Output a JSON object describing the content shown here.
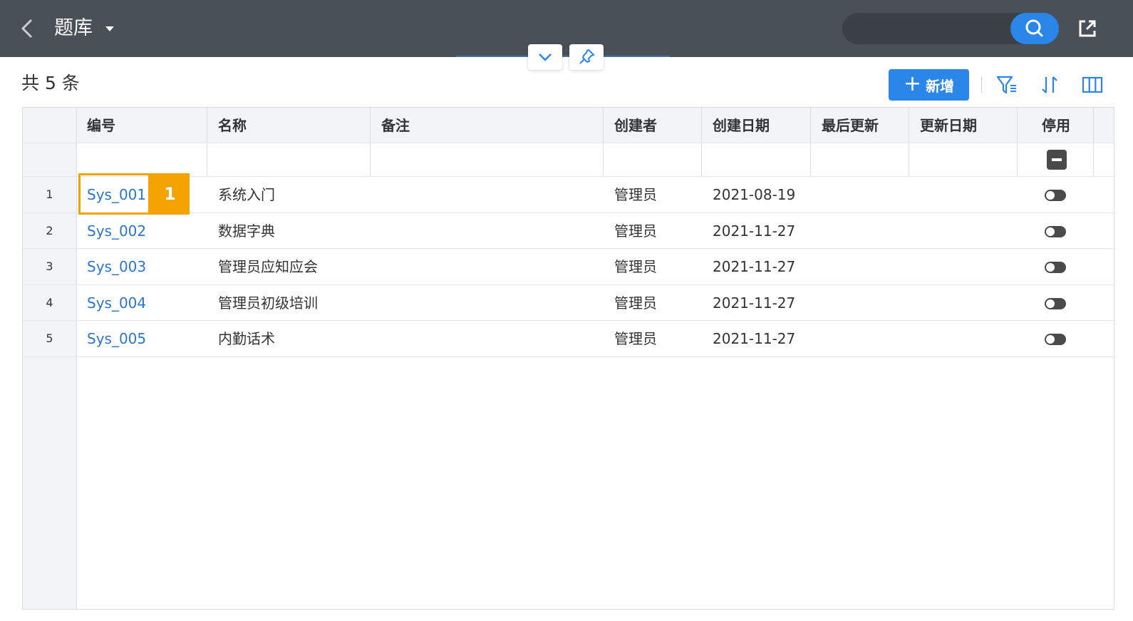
{
  "header": {
    "title": "题库",
    "icons": {
      "back": "chevron-left-icon",
      "caret": "caret-down-icon",
      "search": "search-icon",
      "share": "external-share-icon"
    }
  },
  "toolbar": {
    "total_label": "共 5 条",
    "add_label": "新增",
    "icons": [
      "filter-icon",
      "sort-icon",
      "columns-icon"
    ]
  },
  "table": {
    "columns": [
      "编号",
      "名称",
      "备注",
      "创建者",
      "创建日期",
      "最后更新",
      "更新日期",
      "停用"
    ],
    "rows": [
      {
        "num": "1",
        "code": "Sys_001",
        "name": "系统入门",
        "remark": "",
        "creator": "管理员",
        "created": "2021-08-19",
        "updated_by": "",
        "updated": "",
        "disabled": false
      },
      {
        "num": "2",
        "code": "Sys_002",
        "name": "数据字典",
        "remark": "",
        "creator": "管理员",
        "created": "2021-11-27",
        "updated_by": "",
        "updated": "",
        "disabled": false
      },
      {
        "num": "3",
        "code": "Sys_003",
        "name": "管理员应知应会",
        "remark": "",
        "creator": "管理员",
        "created": "2021-11-27",
        "updated_by": "",
        "updated": "",
        "disabled": false
      },
      {
        "num": "4",
        "code": "Sys_004",
        "name": "管理员初级培训",
        "remark": "",
        "creator": "管理员",
        "created": "2021-11-27",
        "updated_by": "",
        "updated": "",
        "disabled": false
      },
      {
        "num": "5",
        "code": "Sys_005",
        "name": "内勤话术",
        "remark": "",
        "creator": "管理员",
        "created": "2021-11-27",
        "updated_by": "",
        "updated": "",
        "disabled": false
      }
    ]
  },
  "callout": {
    "badge": "1"
  },
  "colors": {
    "header_bg": "#4a5058",
    "accent": "#2a86e8",
    "link": "#2a76d2",
    "callout": "#f5a300"
  }
}
